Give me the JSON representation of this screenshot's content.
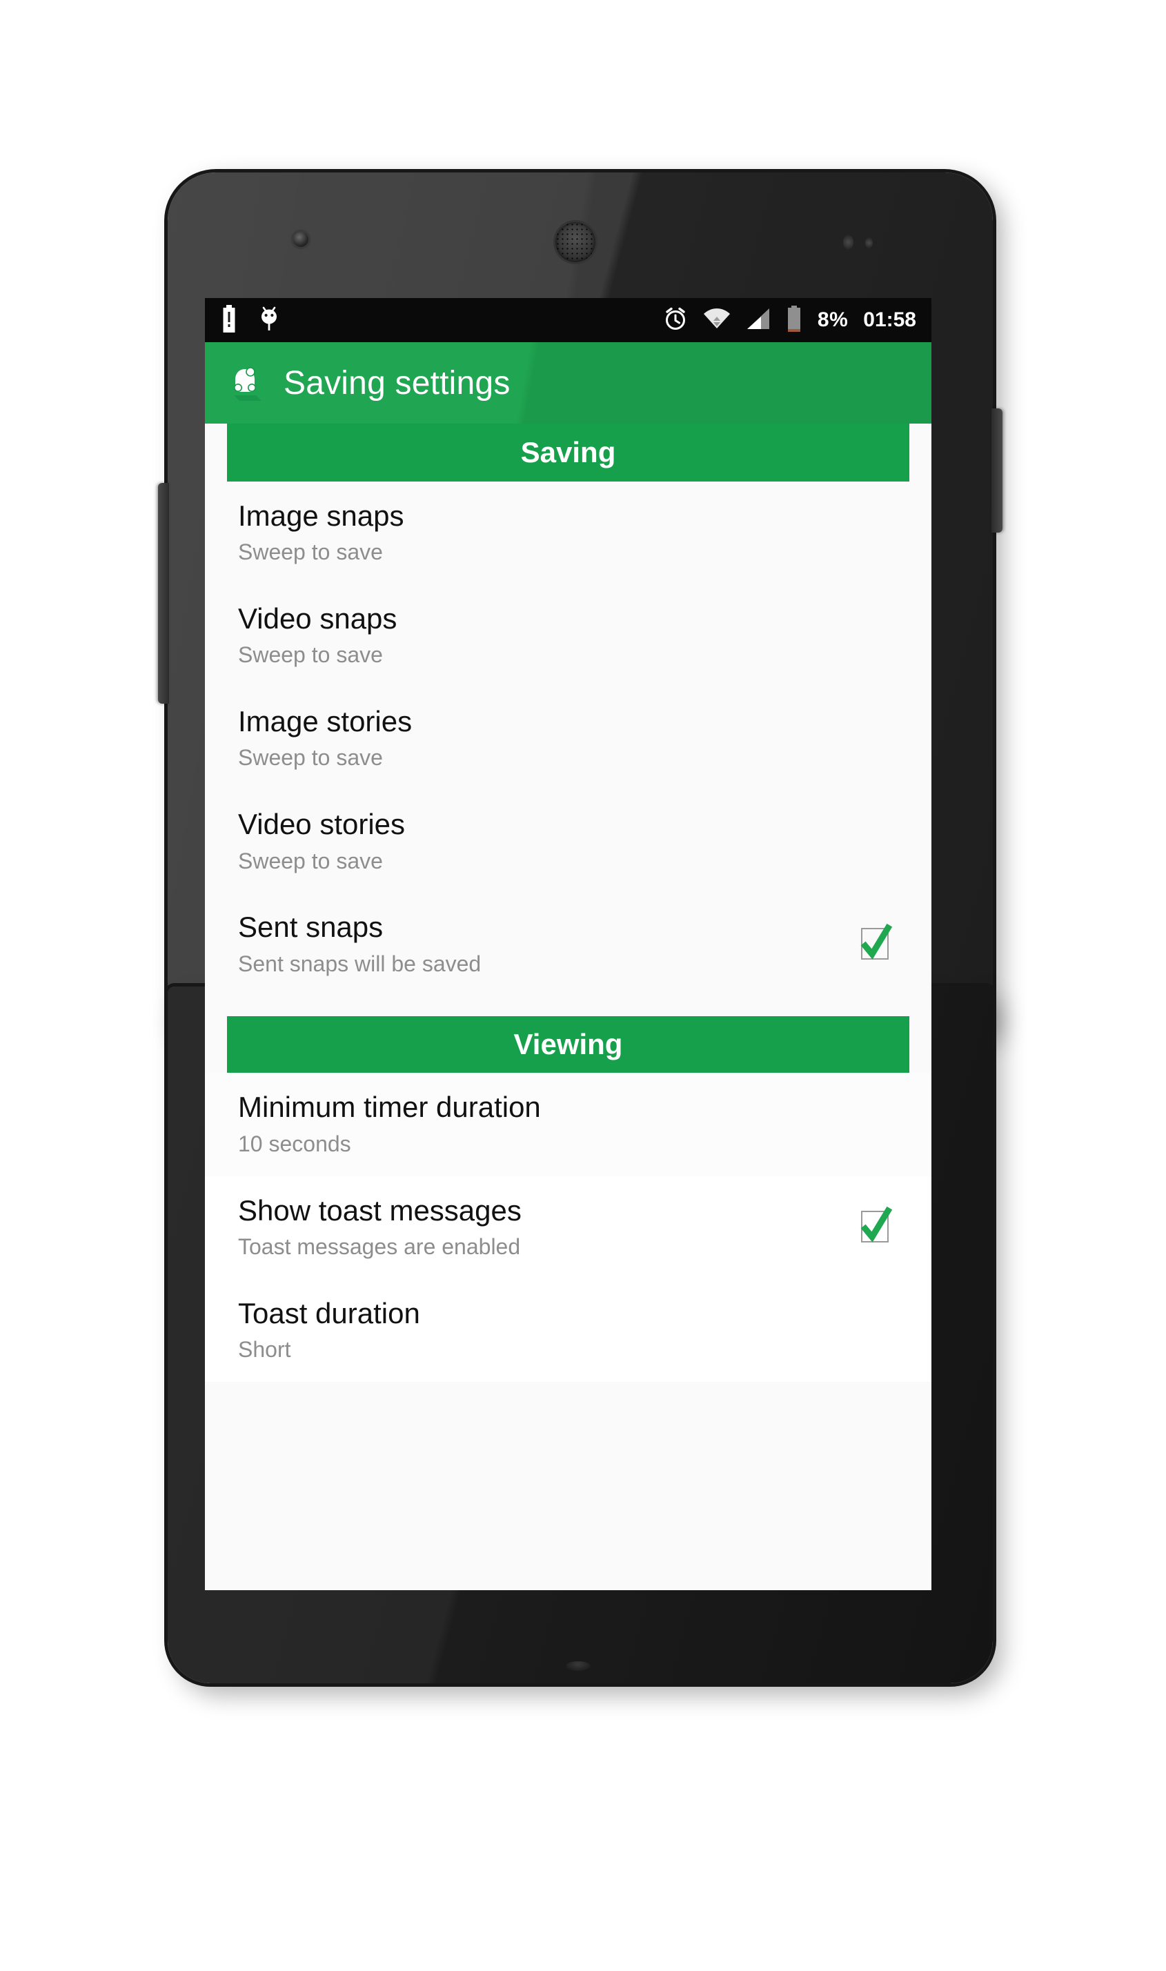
{
  "device": {
    "type": "android-smartphone",
    "body_color": "#2a2a2a"
  },
  "status_bar": {
    "battery_percent": "8%",
    "clock": "01:58",
    "left_icons": [
      "battery-alert-icon",
      "android-bug-icon"
    ],
    "right_icons": [
      "alarm-icon",
      "wifi-icon",
      "signal-icon",
      "battery-icon"
    ],
    "background": "#0a0a0a"
  },
  "action_bar": {
    "title": "Saving settings",
    "icon": "app-ghost-icon",
    "background": "#20a552"
  },
  "theme": {
    "accent_green": "#17a04b",
    "title_color": "#111111",
    "summary_color": "#8d8d8d",
    "screen_background": "#fafafa"
  },
  "sections": [
    {
      "header": "Saving",
      "items": [
        {
          "title": "Image snaps",
          "summary": "Sweep to save",
          "has_checkbox": false,
          "checked": false
        },
        {
          "title": "Video snaps",
          "summary": "Sweep to save",
          "has_checkbox": false,
          "checked": false
        },
        {
          "title": "Image stories",
          "summary": "Sweep to save",
          "has_checkbox": false,
          "checked": false
        },
        {
          "title": "Video stories",
          "summary": "Sweep to save",
          "has_checkbox": false,
          "checked": false
        },
        {
          "title": "Sent snaps",
          "summary": "Sent snaps will be saved",
          "has_checkbox": true,
          "checked": true
        }
      ]
    },
    {
      "header": "Viewing",
      "items": [
        {
          "title": "Minimum timer duration",
          "summary": "10 seconds",
          "has_checkbox": false,
          "checked": false
        },
        {
          "title": "Show toast messages",
          "summary": "Toast messages are enabled",
          "has_checkbox": true,
          "checked": true
        },
        {
          "title": "Toast duration",
          "summary": "Short",
          "has_checkbox": false,
          "checked": false
        }
      ]
    }
  ]
}
